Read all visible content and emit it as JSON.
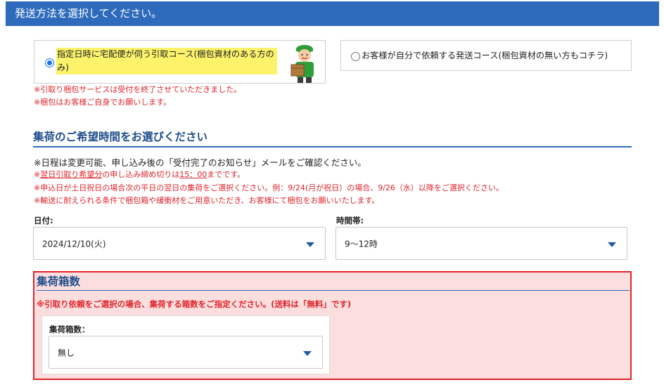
{
  "header": {
    "title": "発送方法を選択してください。"
  },
  "shipping_options": [
    {
      "label": "指定日時に宅配便が伺う引取コース(梱包資材のある方のみ)",
      "selected": true,
      "illustration": "courier-with-box"
    },
    {
      "label": "お客様が自分で依頼する発送コース(梱包資材の無い方もコチラ)",
      "selected": false
    }
  ],
  "pickup_notes": [
    "※引取り梱包サービスは受付を終了させていただきました。",
    "※梱包はお客様ご自身でお願いします。"
  ],
  "pickup_time": {
    "title": "集荷のご希望時間をお選びください",
    "info": "※日程は変更可能、申し込み後の「受付完了のお知らせ」メールをご確認ください。",
    "deadline_note": {
      "prefix": "※",
      "link1": "翌日引取り希望分",
      "middle": "の申し込み締め切りは",
      "link2": "15：00",
      "suffix": "までです。"
    },
    "notes": [
      "※申込日が土日祝日の場合次の平日の翌日の集荷をご選択ください。例：9/24(月が祝日）の場合、9/26（水）以降をご選択ください。",
      "※輸送に耐えられる条件で梱包箱や緩衝材をご用意いただき、お客様にて梱包をお願いいたします。"
    ],
    "date_label": "日付:",
    "date_value": "2024/12/10(火)",
    "time_label": "時間帯:",
    "time_value": "9～12時"
  },
  "box_count": {
    "title": "集荷箱数",
    "note": "※引取り依頼をご選択の場合、集荷する箱数をご指定ください。(送料は「無料」です)",
    "label": "集荷箱数：",
    "value": "無し"
  },
  "colors": {
    "header_bg": "#2e6bbd",
    "accent_blue": "#1f4e8c",
    "warning_red": "#e0242b",
    "highlight_yellow": "#fdf36b",
    "box_section_bg": "#fcdede"
  }
}
